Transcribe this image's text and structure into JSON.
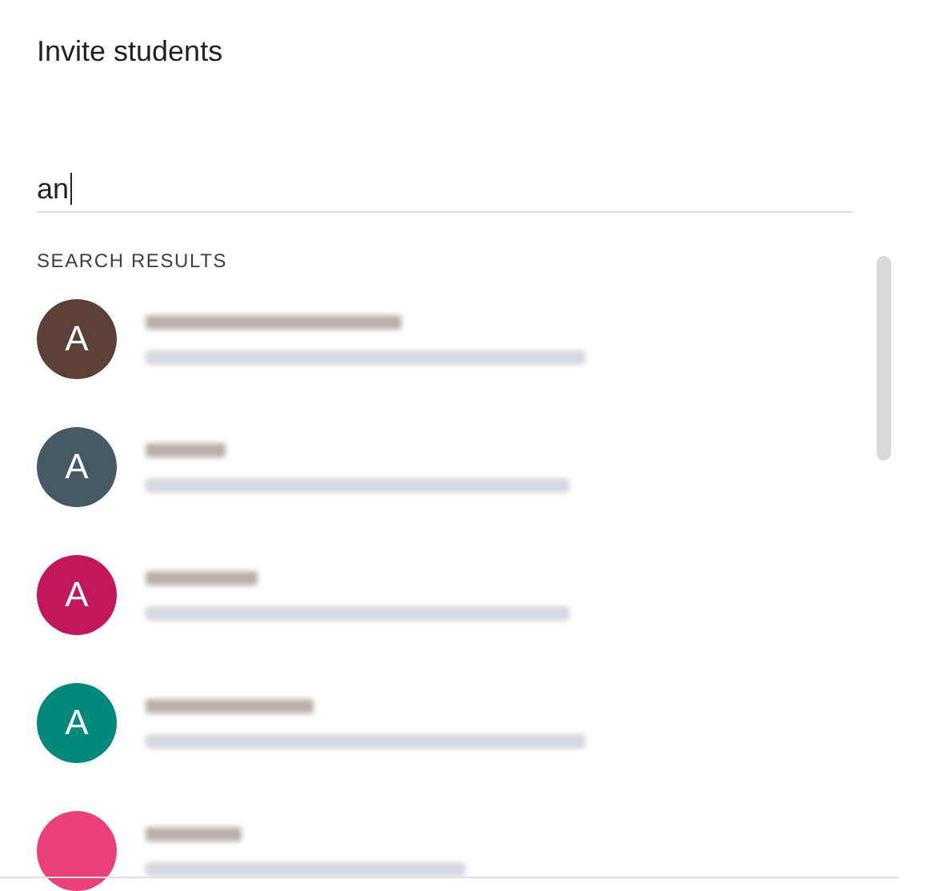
{
  "dialog": {
    "title": "Invite students"
  },
  "search": {
    "value": "an"
  },
  "results": {
    "heading": "SEARCH RESULTS",
    "items": [
      {
        "letter": "A",
        "color": "#5d4037"
      },
      {
        "letter": "A",
        "color": "#455a64"
      },
      {
        "letter": "A",
        "color": "#c2185b"
      },
      {
        "letter": "A",
        "color": "#00897b"
      },
      {
        "color": "#ec407a"
      }
    ]
  }
}
